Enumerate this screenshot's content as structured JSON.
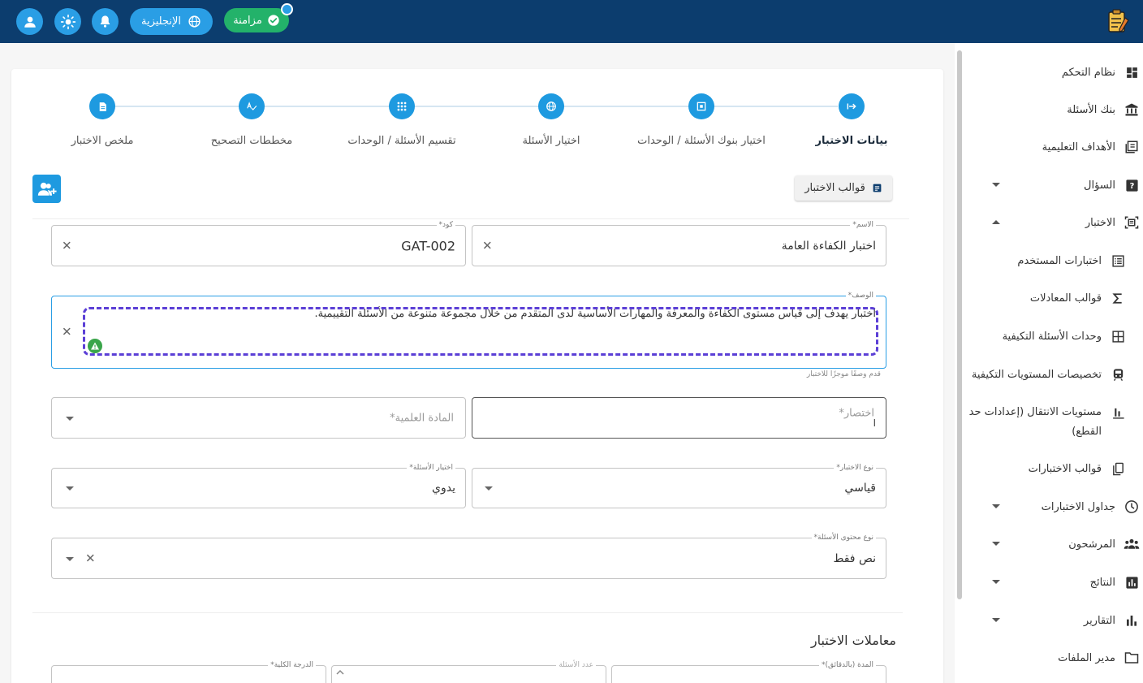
{
  "header": {
    "sync_label": "مزامنة",
    "language_label": "الإنجليزية",
    "icons": [
      "user-icon",
      "sun-icon",
      "bell-icon",
      "globe-icon",
      "check-icon"
    ]
  },
  "stepper": {
    "steps": [
      {
        "label": "بيانات الاختبار",
        "active": true
      },
      {
        "label": "اختيار بنوك الأسئلة / الوحدات"
      },
      {
        "label": "اختيار الأسئلة"
      },
      {
        "label": "تقسيم الأسئلة / الوحدات"
      },
      {
        "label": "مخططات التصحيح"
      },
      {
        "label": "ملخص الاختبار"
      }
    ]
  },
  "toolbar": {
    "templates_label": "قوالب الاختبار"
  },
  "form": {
    "name": {
      "label": "الاسم*",
      "value": "اختبار الكفاءة العامة"
    },
    "code": {
      "label": "كود*",
      "value": "GAT-002"
    },
    "description": {
      "label": "الوصف*",
      "value": "اختبار يهدف إلى قياس مستوى الكفاءة والمعرفة والمهارات الأساسية لدى المتقدم من خلال مجموعة متنوعة من الأسئلة التقييمية.",
      "helper": "قدم وصفًا موجزًا للاختبار"
    },
    "abbreviation": {
      "placeholder": "اختصار*",
      "value": "ا"
    },
    "subject": {
      "placeholder": "المادة العلمية*"
    },
    "test_type": {
      "label": "نوع الاختبار*",
      "value": "قياسي"
    },
    "question_selection": {
      "label": "اختيار الأسئلة*",
      "value": "يدوي"
    },
    "question_content_type": {
      "label": "نوع محتوى الأسئلة*",
      "value": "نص فقط"
    }
  },
  "parameters": {
    "title": "معاملات الاختبار",
    "duration_label": "المدة (بالدقائق)*",
    "question_count_label": "عدد الأسئلة",
    "total_score_label": "الدرجة الكلية*"
  },
  "sidebar": {
    "items": [
      {
        "label": "نظام التحكم",
        "icon": "dashboard-icon"
      },
      {
        "label": "بنك الأسئلة",
        "icon": "bank-icon"
      },
      {
        "label": "الأهداف التعليمية",
        "icon": "objectives-icon"
      },
      {
        "label": "السؤال",
        "icon": "question-icon"
      },
      {
        "label": "الاختبار",
        "icon": "exam-icon"
      },
      {
        "label": "اختبارات المستخدم",
        "icon": "list-icon"
      },
      {
        "label": "قوالب المعادلات",
        "icon": "sigma-icon"
      },
      {
        "label": "وحدات الأسئلة التكيفية",
        "icon": "grid-icon"
      },
      {
        "label": "تخصيصات المستويات التكيفية",
        "icon": "train-icon"
      },
      {
        "label": "مستويات الانتقال (إعدادات حد القطع)",
        "icon": "bar-chart-icon"
      },
      {
        "label": "قوالب الاختبارات",
        "icon": "templates-icon"
      },
      {
        "label": "جداول الاختبارات",
        "icon": "clock-icon"
      },
      {
        "label": "المرشحون",
        "icon": "people-icon"
      },
      {
        "label": "النتائج",
        "icon": "results-icon"
      },
      {
        "label": "التقارير",
        "icon": "reports-icon"
      },
      {
        "label": "مدير الملفات",
        "icon": "folder-icon"
      }
    ]
  },
  "colors": {
    "topbar": "#0c3d6e",
    "accent": "#1e9ae0",
    "sync": "#23b26a",
    "highlight": "#5b3fd6"
  }
}
